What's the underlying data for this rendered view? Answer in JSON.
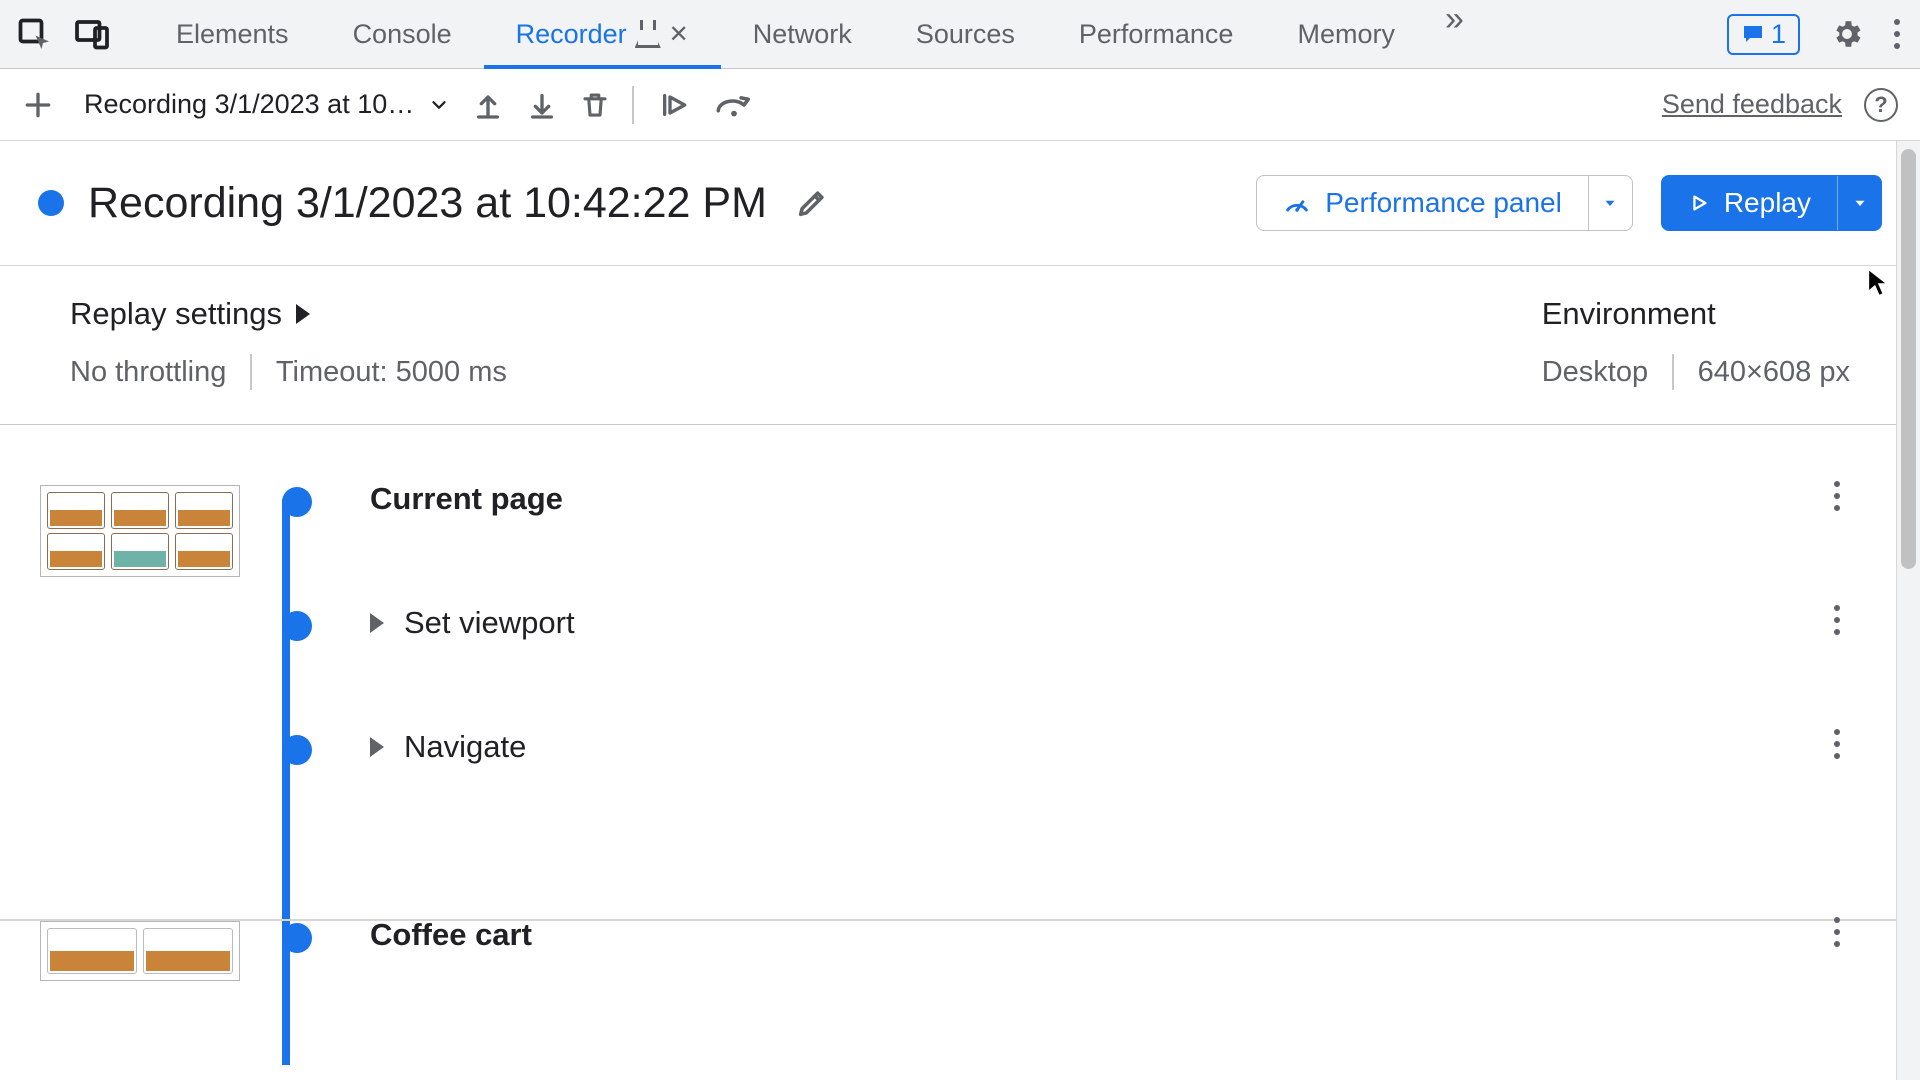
{
  "colors": {
    "accent": "#1a73e8"
  },
  "tabs": {
    "items": [
      "Elements",
      "Console",
      "Recorder",
      "Network",
      "Sources",
      "Performance",
      "Memory"
    ],
    "activeIndex": 2
  },
  "issuesBadge": {
    "count": "1"
  },
  "toolbar": {
    "recordingSelect": "Recording 3/1/2023 at 10…",
    "feedbackLink": "Send feedback"
  },
  "title": {
    "name": "Recording 3/1/2023 at 10:42:22 PM"
  },
  "perfButton": {
    "label": "Performance panel"
  },
  "replayButton": {
    "label": "Replay"
  },
  "replaySettings": {
    "header": "Replay settings",
    "throttling": "No throttling",
    "timeout": "Timeout: 5000 ms"
  },
  "environment": {
    "header": "Environment",
    "device": "Desktop",
    "viewport": "640×608 px"
  },
  "steps": {
    "s1": {
      "label": "Current page"
    },
    "s2": {
      "label": "Set viewport"
    },
    "s3": {
      "label": "Navigate"
    },
    "s4": {
      "label": "Coffee cart"
    }
  }
}
